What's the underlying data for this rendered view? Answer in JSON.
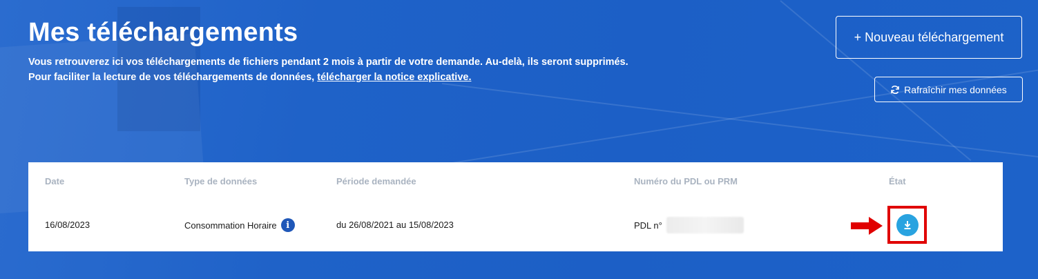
{
  "page": {
    "title": "Mes téléchargements",
    "description_line1": "Vous retrouverez ici vos téléchargements de fichiers pendant 2 mois à partir de votre demande. Au-delà, ils seront supprimés.",
    "description_line2_prefix": "Pour faciliter la lecture de vos téléchargements de données, ",
    "notice_link": "télécharger la notice explicative."
  },
  "actions": {
    "new_download": "+ Nouveau téléchargement",
    "refresh": "Rafraîchir mes données"
  },
  "table": {
    "headers": {
      "date": "Date",
      "type": "Type de données",
      "period": "Période demandée",
      "pdl": "Numéro du PDL ou PRM",
      "state": "État"
    },
    "rows": [
      {
        "date": "16/08/2023",
        "type": "Consommation Horaire",
        "period": "du 26/08/2021 au 15/08/2023",
        "pdl_prefix": "PDL n°"
      }
    ]
  },
  "icons": {
    "info": "info-icon",
    "refresh": "refresh-icon",
    "download": "download-icon",
    "annotation": "red-arrow-icon"
  },
  "colors": {
    "background": "#1f63c9",
    "header_text": "#a9b3c0",
    "download_button": "#29a3e0",
    "info_icon": "#1f57b8",
    "annotation": "#e00000"
  }
}
